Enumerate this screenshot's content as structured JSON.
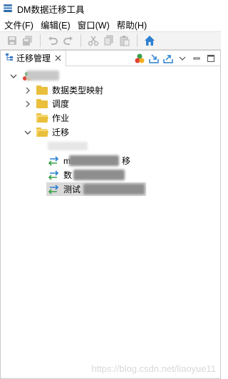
{
  "window": {
    "title": "DM数据迁移工具"
  },
  "menubar": {
    "items": [
      "文件(F)",
      "编辑(E)",
      "窗口(W)",
      "帮助(H)"
    ]
  },
  "panel": {
    "tab_label": "迁移管理"
  },
  "tree": {
    "folders": [
      {
        "label": "数据类型映射",
        "expanded": false
      },
      {
        "label": "调度",
        "expanded": false
      },
      {
        "label": "作业",
        "expanded": null
      },
      {
        "label": "迁移",
        "expanded": true
      }
    ],
    "migrations": [
      {
        "label_visible": "m",
        "label_tail": "移"
      },
      {
        "label_visible": "数",
        "label_tail": ""
      },
      {
        "label_visible": "测试",
        "label_tail": "",
        "selected": true
      }
    ]
  },
  "watermark": "https://blog.csdn.net/liaoyue11"
}
